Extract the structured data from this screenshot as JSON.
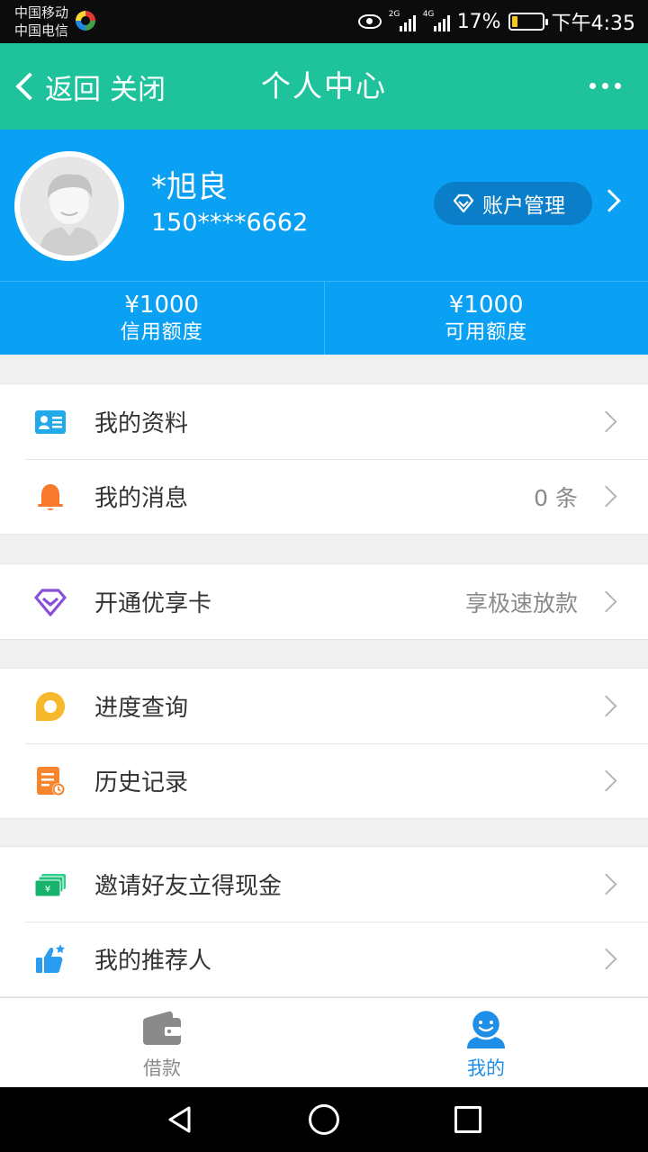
{
  "status_bar": {
    "carrier_1": "中国移动",
    "carrier_2": "中国电信",
    "network_1": "2G",
    "network_2": "4G",
    "battery": "17%",
    "time": "下午4:35"
  },
  "titlebar": {
    "back_label": "返回",
    "close_label": "关闭",
    "title": "个人中心"
  },
  "profile": {
    "name": "*旭良",
    "phone": "150****6662",
    "account_button": "账户管理"
  },
  "quota": [
    {
      "amount": "¥1000",
      "label": "信用额度"
    },
    {
      "amount": "¥1000",
      "label": "可用额度"
    }
  ],
  "menu": {
    "my_profile": "我的资料",
    "my_messages": "我的消息",
    "messages_count": "0 条",
    "vip_card": "开通优享卡",
    "vip_card_value": "享极速放款",
    "progress": "进度查询",
    "history": "历史记录",
    "invite": "邀请好友立得现金",
    "referrer": "我的推荐人"
  },
  "tabs": [
    {
      "label": "借款",
      "active": false
    },
    {
      "label": "我的",
      "active": true
    }
  ],
  "colors": {
    "titlebar": "#1ec39b",
    "profile_blue": "#0aa1f4",
    "active_tab": "#1e8ee6",
    "inactive_tab": "#8a8a8a"
  }
}
